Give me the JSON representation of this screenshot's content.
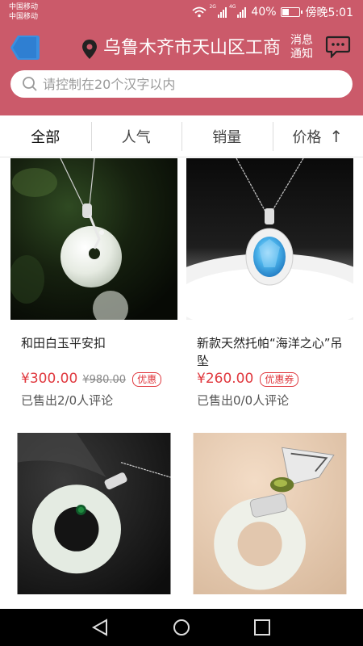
{
  "status_bar": {
    "carrier_1": "中国移动",
    "carrier_2": "中国移动",
    "signal_tag_1": "2G",
    "signal_tag_2": "4G",
    "battery": "40%",
    "battery_level": 0.4,
    "time": "傍晚5:01"
  },
  "header": {
    "location": "乌鲁木齐市天山区工商",
    "messages_label_line1": "消息",
    "messages_label_line2": "通知",
    "background_color": "#cb5a6a"
  },
  "search": {
    "placeholder": "请控制在20个汉字以内"
  },
  "tabs": [
    {
      "label": "全部",
      "active": true
    },
    {
      "label": "人气"
    },
    {
      "label": "销量"
    },
    {
      "label": "价格",
      "arrow": "↑"
    }
  ],
  "products": [
    {
      "title": "和田白玉平安扣",
      "price": "¥300.00",
      "original_price": "¥980.00",
      "badge": "优惠",
      "sold": "已售出2/0人评论"
    },
    {
      "title": "新款天然托帕“海洋之心”吊坠",
      "price": "¥260.00",
      "badge": "优惠券",
      "sold": "已售出0/0人评论"
    },
    {
      "title": "",
      "price": "",
      "sold": ""
    },
    {
      "title": "",
      "price": "",
      "sold": ""
    }
  ],
  "colors": {
    "accent_red": "#e0383e",
    "nav_bar": "#000000"
  },
  "icons": [
    "back-icon",
    "location-pin-icon",
    "message-icon",
    "search-icon",
    "wifi-icon",
    "signal-icon",
    "battery-icon",
    "nav-back-icon",
    "nav-home-icon",
    "nav-recents-icon"
  ]
}
